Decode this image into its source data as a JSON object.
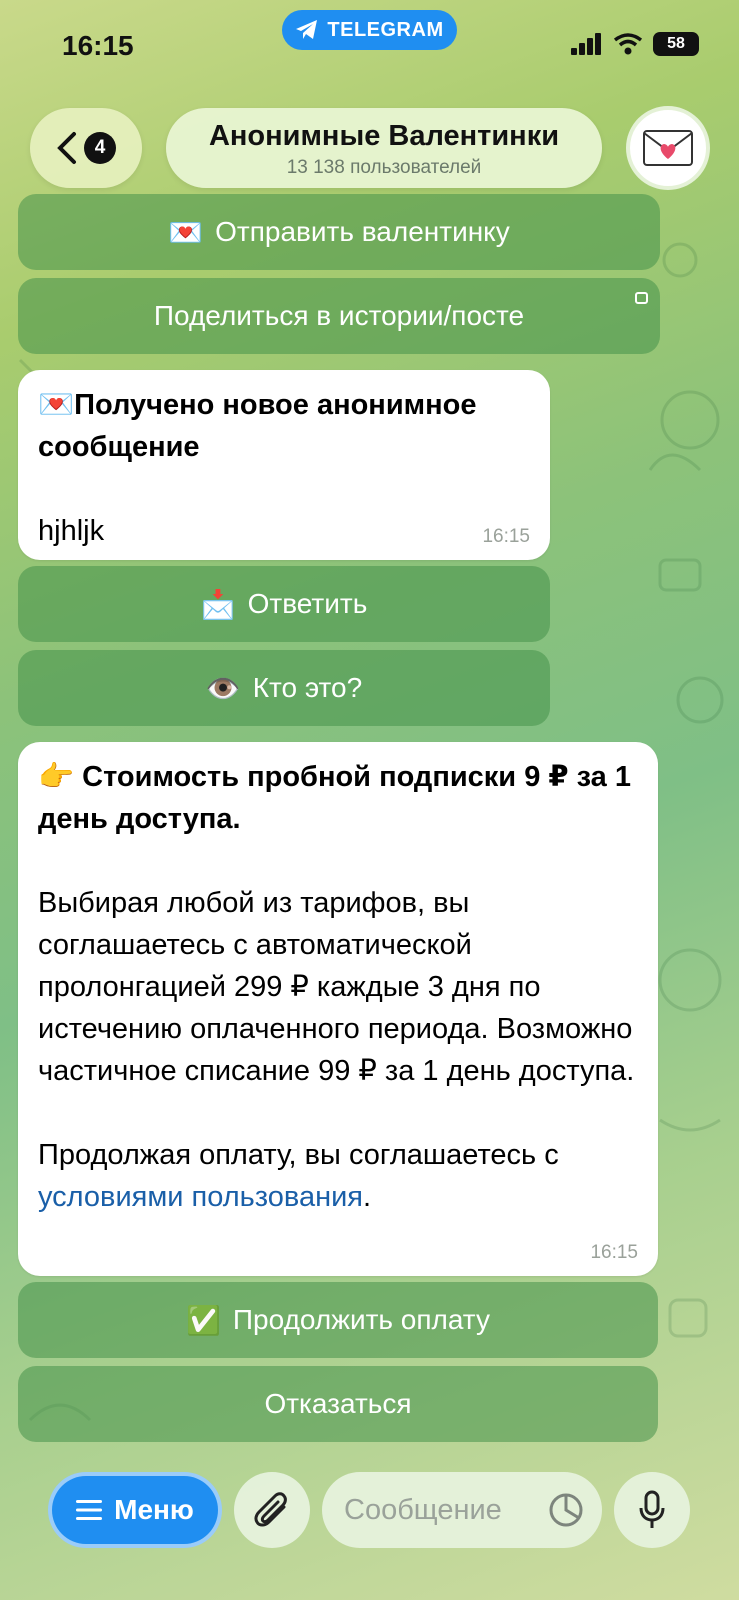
{
  "status_bar": {
    "time": "16:15",
    "app_pill": "TELEGRAM",
    "battery": "58"
  },
  "header": {
    "unread_count": "4",
    "title": "Анонимные Валентинки",
    "subtitle": "13 138 пользователей"
  },
  "top_buttons": {
    "send_valentine": "Отправить валентинку",
    "send_valentine_emoji": "💌",
    "share_story": "Поделиться в истории/посте"
  },
  "message1": {
    "emoji": "💌",
    "heading": "Получено новое анонимное сообщение",
    "body": "hjhljk",
    "time": "16:15"
  },
  "message1_buttons": {
    "reply_emoji": "📩",
    "reply": "Ответить",
    "who_emoji": "👁️",
    "who": "Кто это?"
  },
  "message2": {
    "emoji": "👉",
    "heading": "Стоимость пробной подписки 9 ₽ за 1 день доступа.",
    "paragraph": "Выбирая любой из тарифов, вы соглашаетесь с автоматической пролонгацией 299 ₽ каждые 3 дня по истечению оплаченного периода. Возможно частичное списание 99 ₽ за 1 день доступа.",
    "terms_prefix": "Продолжая оплату, вы соглашаетесь с",
    "terms_link": "условиями пользования",
    "terms_suffix": ".",
    "time": "16:15"
  },
  "message2_buttons": {
    "continue_emoji": "✅",
    "continue": "Продолжить оплату",
    "decline": "Отказаться"
  },
  "composer": {
    "menu_label": "Меню",
    "placeholder": "Сообщение"
  },
  "colors": {
    "accent_blue": "#1f8ef1",
    "link_blue": "#1a5fa8"
  }
}
